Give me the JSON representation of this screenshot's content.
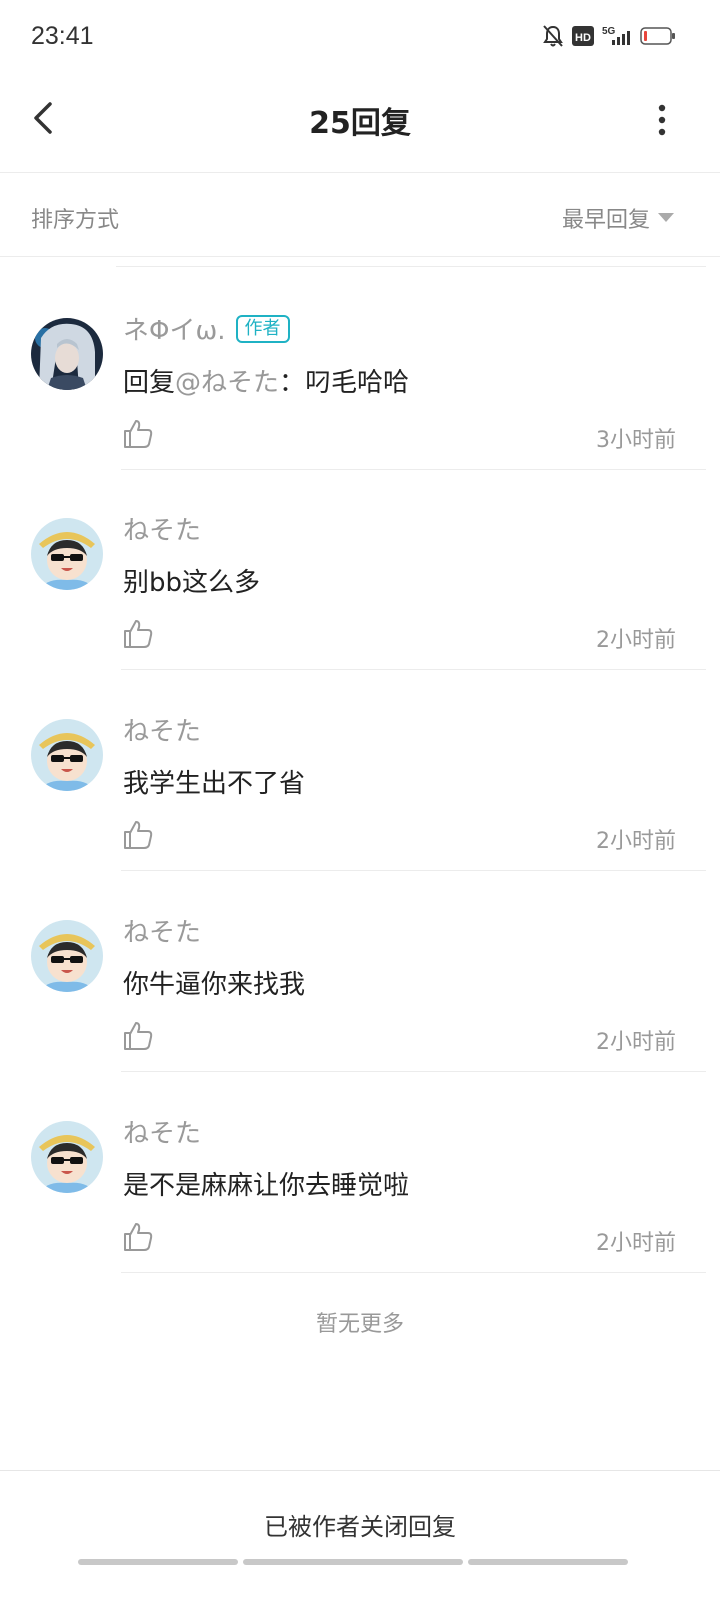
{
  "status_bar": {
    "time": "23:41",
    "icons": [
      "bell-off-icon",
      "hd-icon",
      "5g-signal-icon",
      "battery-low-icon"
    ],
    "hd_label": "HD",
    "network_label": "5G"
  },
  "header": {
    "title": "25回复",
    "back_icon": "chevron-left-icon",
    "more_icon": "more-vertical-icon"
  },
  "sort": {
    "label": "排序方式",
    "selected": "最早回复"
  },
  "replies": [
    {
      "username": "ネΦイω.",
      "is_author": true,
      "badge": "作者",
      "mention_prefix": "回复",
      "mention": "@ねそた",
      "text": "：叼毛哈哈",
      "time": "3小时前"
    },
    {
      "username": "ねそた",
      "text": "别bb这么多",
      "time": "2小时前"
    },
    {
      "username": "ねそた",
      "text": "我学生出不了省",
      "time": "2小时前"
    },
    {
      "username": "ねそた",
      "text": "你牛逼你来找我",
      "time": "2小时前"
    },
    {
      "username": "ねそた",
      "text": "是不是麻麻让你去睡觉啦",
      "time": "2小时前"
    }
  ],
  "no_more": "暂无更多",
  "footer": {
    "closed_text": "已被作者关闭回复"
  },
  "colors": {
    "accent": "#1fb2c4",
    "muted_text": "#999999",
    "divider": "#ececec"
  }
}
